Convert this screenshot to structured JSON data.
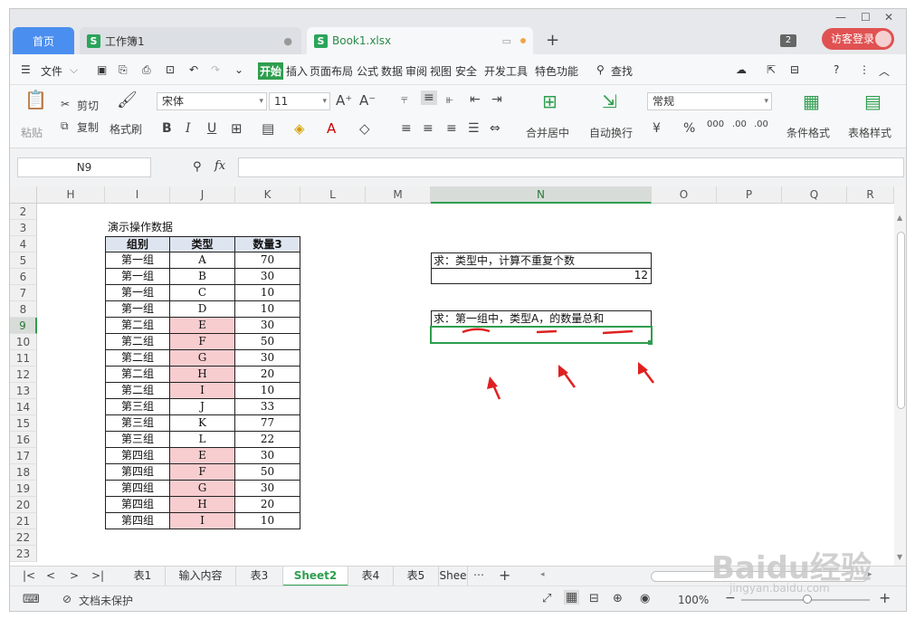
{
  "window": {
    "controls": [
      "—",
      "☐",
      "✕"
    ]
  },
  "tabs": {
    "home": "首页",
    "t1": "工作簿1",
    "t2": "Book1.xlsx",
    "count": "2",
    "login": "访客登录"
  },
  "menu": [
    "文件",
    "开始",
    "插入",
    "页面布局",
    "公式",
    "数据",
    "审阅",
    "视图",
    "安全",
    "开发工具",
    "特色功能",
    "查找"
  ],
  "ribbon": {
    "paste": "粘贴",
    "cut": "剪切",
    "copy": "复制",
    "format_painter": "格式刷",
    "font_name": "宋体",
    "font_size": "11",
    "merge": "合并居中",
    "wrap": "自动换行",
    "number_format": "常规",
    "cond_format": "条件格式",
    "table_style": "表格样式"
  },
  "formula_bar": {
    "name_box": "N9",
    "fx": "fx",
    "formula": ""
  },
  "columns": [
    "H",
    "I",
    "J",
    "K",
    "L",
    "M",
    "N",
    "O",
    "P",
    "Q",
    "R"
  ],
  "rows": [
    "2",
    "3",
    "4",
    "5",
    "6",
    "7",
    "8",
    "9",
    "10",
    "11",
    "12",
    "13",
    "14",
    "15",
    "16",
    "17",
    "18",
    "19",
    "20",
    "21",
    "22",
    "23"
  ],
  "selected": {
    "col": "N",
    "row": "9"
  },
  "table": {
    "title": "演示操作数据",
    "headers": [
      "组别",
      "类型",
      "数量3"
    ],
    "rows": [
      [
        "第一组",
        "A",
        "70"
      ],
      [
        "第一组",
        "B",
        "30"
      ],
      [
        "第一组",
        "C",
        "10"
      ],
      [
        "第一组",
        "D",
        "10"
      ],
      [
        "第二组",
        "E",
        "30"
      ],
      [
        "第二组",
        "F",
        "50"
      ],
      [
        "第二组",
        "G",
        "30"
      ],
      [
        "第二组",
        "H",
        "20"
      ],
      [
        "第二组",
        "I",
        "10"
      ],
      [
        "第三组",
        "J",
        "33"
      ],
      [
        "第三组",
        "K",
        "77"
      ],
      [
        "第三组",
        "L",
        "22"
      ],
      [
        "第四组",
        "E",
        "30"
      ],
      [
        "第四组",
        "F",
        "50"
      ],
      [
        "第四组",
        "G",
        "30"
      ],
      [
        "第四组",
        "H",
        "20"
      ],
      [
        "第四组",
        "I",
        "10"
      ]
    ],
    "highlight_color": "#f8cdd0"
  },
  "question1": {
    "text": "求：类型中，计算不重复个数",
    "answer": "12"
  },
  "question2": {
    "text": "求：第一组中，类型A，的数量总和",
    "answer": ""
  },
  "sheet_tabs": [
    "表1",
    "输入内容",
    "表3",
    "Sheet2",
    "表4",
    "表5",
    "Shee"
  ],
  "active_sheet": "Sheet2",
  "status": {
    "protect": "文档未保护",
    "zoom": "100%"
  },
  "watermark": {
    "brand": "Baidu经验",
    "url": "jingyan.baidu.com"
  },
  "colors": {
    "accent": "#2e9e4e",
    "home_tab": "#4a8ef0",
    "login": "#e05252",
    "annotation": "#e02020"
  }
}
